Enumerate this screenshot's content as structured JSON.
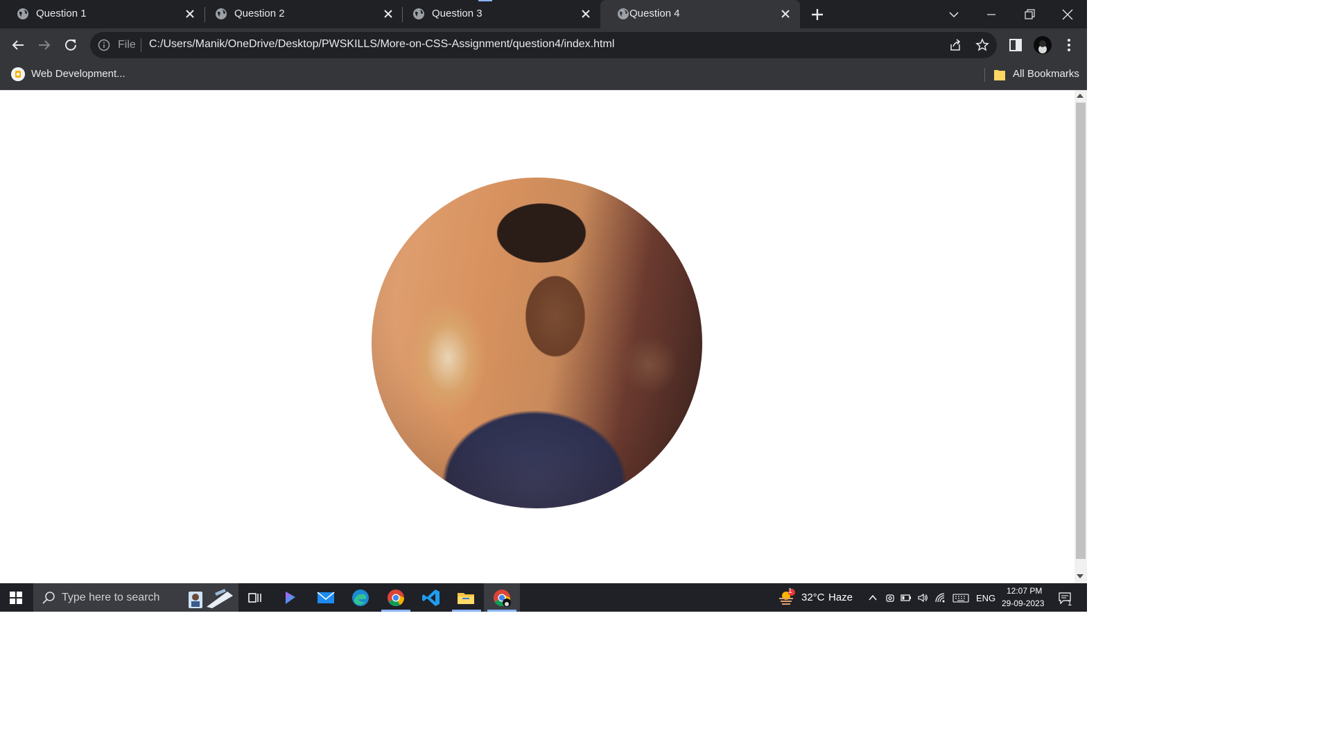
{
  "tabs": [
    {
      "title": "Question 1"
    },
    {
      "title": "Question 2"
    },
    {
      "title": "Question 3"
    },
    {
      "title": "Question 4",
      "active": true
    }
  ],
  "address_bar": {
    "scheme_label": "File",
    "url": "C:/Users/Manik/OneDrive/Desktop/PWSKILLS/More-on-CSS-Assignment/question4/index.html"
  },
  "bookmarks": {
    "items": [
      {
        "label": "Web Development..."
      }
    ],
    "all_bookmarks_label": "All Bookmarks"
  },
  "page": {
    "image": {
      "shape": "circle",
      "subject": "profile photo"
    }
  },
  "taskbar": {
    "search_placeholder": "Type here to search",
    "weather_temp": "32°C",
    "weather_condition": "Haze",
    "language": "ENG",
    "time": "12:07 PM",
    "date": "29-09-2023",
    "notification_count": "1",
    "weather_alert_count": "1"
  },
  "colors": {
    "tabstrip_bg": "#202124",
    "toolbar_bg": "#35363a",
    "taskbar_bg": "#1f2126",
    "page_bg": "#ffffff"
  },
  "icons": [
    "globe-icon",
    "close-icon",
    "plus-icon",
    "chevron-down-icon",
    "minimize-icon",
    "restore-icon",
    "back-arrow-icon",
    "forward-arrow-icon",
    "reload-icon",
    "info-icon",
    "share-icon",
    "star-icon",
    "side-panel-icon",
    "avatar",
    "kebab-menu-icon",
    "folder-icon",
    "windows-logo-icon",
    "search-icon",
    "task-view-icon",
    "edge-icon",
    "mail-icon",
    "chrome-icon",
    "vscode-icon",
    "file-explorer-icon",
    "notification-icon"
  ]
}
